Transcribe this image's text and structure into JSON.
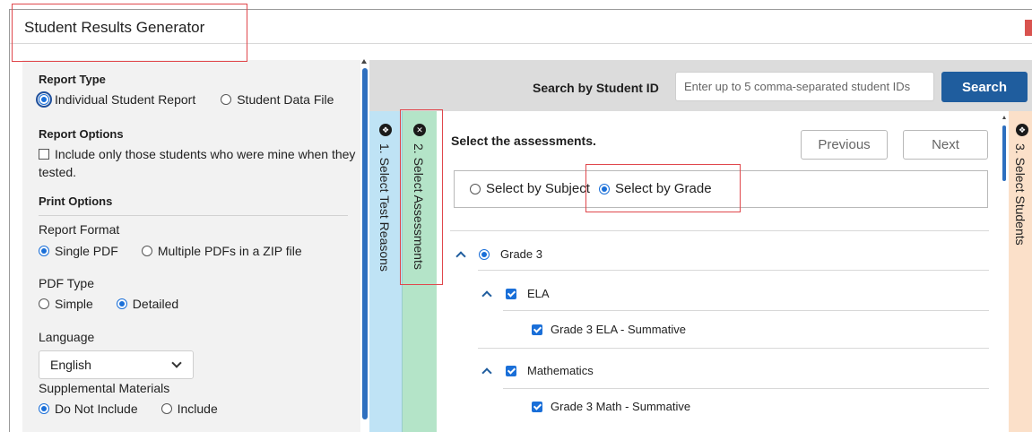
{
  "app": {
    "title": "Student Results Generator"
  },
  "left_panel": {
    "report_type": {
      "heading": "Report Type",
      "options": [
        "Individual Student Report",
        "Student Data File"
      ],
      "selected": "Individual Student Report"
    },
    "report_options": {
      "heading": "Report Options",
      "checkbox_label_line1": "Include only those students who were mine when they",
      "checkbox_label_line2": "tested.",
      "checked": false
    },
    "print_options": {
      "heading": "Print Options"
    },
    "report_format": {
      "label": "Report Format",
      "options": [
        "Single PDF",
        "Multiple PDFs in a ZIP file"
      ],
      "selected": "Single PDF"
    },
    "pdf_type": {
      "label": "PDF Type",
      "options": [
        "Simple",
        "Detailed"
      ],
      "selected": "Detailed"
    },
    "language": {
      "label": "Language",
      "value": "English"
    },
    "supplemental": {
      "label": "Supplemental Materials",
      "options": [
        "Do Not Include",
        "Include"
      ],
      "selected": "Do Not Include"
    }
  },
  "search": {
    "label": "Search by Student ID",
    "placeholder": "Enter up to 5 comma-separated student IDs",
    "button": "Search"
  },
  "steps": [
    {
      "label": "1. Select Test Reasons",
      "icon": "expand-icon"
    },
    {
      "label": "2. Select Assessments",
      "icon": "close-icon"
    },
    {
      "label": "3. Select Students",
      "icon": "expand-icon"
    }
  ],
  "main": {
    "title": "Select the assessments.",
    "previous": "Previous",
    "next": "Next",
    "modes": [
      "Select by Subject",
      "Select by Grade"
    ],
    "selected_mode": "Select by Grade",
    "tree": {
      "grade": "Grade 3",
      "subjects": [
        {
          "name": "ELA",
          "assessment": "Grade 3 ELA - Summative"
        },
        {
          "name": "Mathematics",
          "assessment": "Grade 3 Math - Summative"
        }
      ]
    }
  },
  "colors": {
    "accent": "#1f5d9e",
    "radio": "#1a6fd8",
    "step1": "#bfe3f5",
    "step2": "#b4e4c8",
    "step3": "#fbe0c9",
    "annotation": "#e0474c"
  }
}
